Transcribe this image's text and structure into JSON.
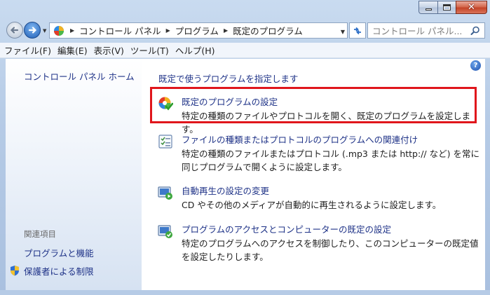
{
  "window": {
    "min_label": "minimize",
    "max_label": "maximize",
    "close_label": "close"
  },
  "address": {
    "crumbs": [
      "コントロール パネル",
      "プログラム",
      "既定のプログラム"
    ]
  },
  "search": {
    "placeholder": "コントロール パネル..."
  },
  "menu": {
    "items": [
      "ファイル(F)",
      "編集(E)",
      "表示(V)",
      "ツール(T)",
      "ヘルプ(H)"
    ]
  },
  "sidebar": {
    "home": "コントロール パネル ホーム",
    "related_heading": "関連項目",
    "links": [
      "プログラムと機能",
      "保護者による制限"
    ]
  },
  "main": {
    "heading": "既定で使うプログラムを指定します",
    "entries": [
      {
        "title": "既定のプログラムの設定",
        "desc": "特定の種類のファイルやプロトコルを開く、既定のプログラムを設定します。",
        "icon": "default-programs-icon"
      },
      {
        "title": "ファイルの種類またはプロトコルのプログラムへの関連付け",
        "desc": "特定の種類のファイルまたはプロトコル (.mp3 または http:// など) を常に同じプログラムで開くように設定します。",
        "icon": "file-association-icon"
      },
      {
        "title": "自動再生の設定の変更",
        "desc": "CD やその他のメディアが自動的に再生されるように設定します。",
        "icon": "autoplay-icon"
      },
      {
        "title": "プログラムのアクセスとコンピューターの既定の設定",
        "desc": "特定のプログラムへのアクセスを制御したり、このコンピューターの既定値を設定したりします。",
        "icon": "program-access-icon"
      }
    ]
  },
  "colors": {
    "link": "#1e3287",
    "highlight": "#e0161c",
    "close_button": "#c44428"
  }
}
